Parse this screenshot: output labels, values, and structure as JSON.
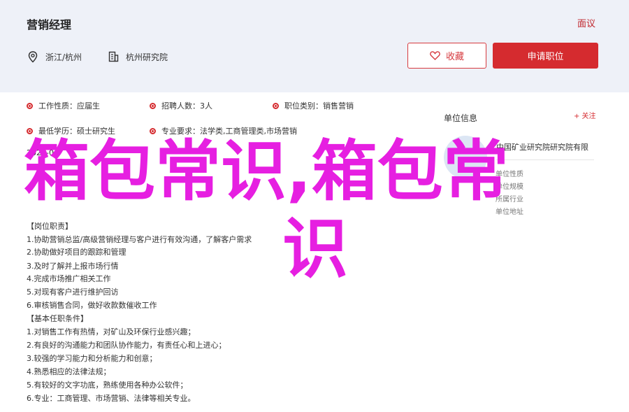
{
  "header": {
    "job_title": "营销经理",
    "report": "面议",
    "location": "浙江/杭州",
    "company": "杭州研究院",
    "favorite_label": "收藏",
    "apply_label": "申请职位"
  },
  "attributes": [
    {
      "label": "工作性质：",
      "value": "应届生"
    },
    {
      "label": "招聘人数：",
      "value": "3人"
    },
    {
      "label": "职位类别：",
      "value": "销售营销"
    },
    {
      "label": "最低学历：",
      "value": "硕士研究生"
    },
    {
      "label": "专业要求：",
      "value": "法学类,工商管理类,市场营销"
    }
  ],
  "date_partial": "2023-06",
  "description": {
    "duty_title": "【岗位职责】",
    "duties": [
      "1.协助营销总监/高级营销经理与客户进行有效沟通，了解客户需求",
      "2.协助做好项目的跟踪和管理",
      "3.及时了解并上报市场行情",
      "4.完成市场推广相关工作",
      "5.对现有客户进行维护回访",
      "6.审核销售合同，做好收款数催收工作"
    ],
    "req_title": "【基本任职条件】",
    "requirements": [
      "1.对销售工作有热情，对矿山及环保行业感兴趣；",
      "2.有良好的沟通能力和团队协作能力，有责任心和上进心；",
      "3.较强的学习能力和分析能力和创意；",
      "4.熟悉相应的法律法规；",
      "5.有较好的文字功底，熟练使用各种办公软件；",
      "6.专业：工商管理、市场营销、法律等相关专业。"
    ]
  },
  "unit": {
    "title": "单位信息",
    "follow": "+ 关注",
    "name": "中国矿业研究院研究院有限",
    "details": [
      "单位性质",
      "单位规模",
      "所属行业",
      "单位地址"
    ]
  },
  "watermark": {
    "line1": "箱包常识,箱包常",
    "line2": "识"
  },
  "colors": {
    "accent": "#d52b2f",
    "header_bg": "#eef1f8",
    "watermark": "#e61fe1"
  }
}
